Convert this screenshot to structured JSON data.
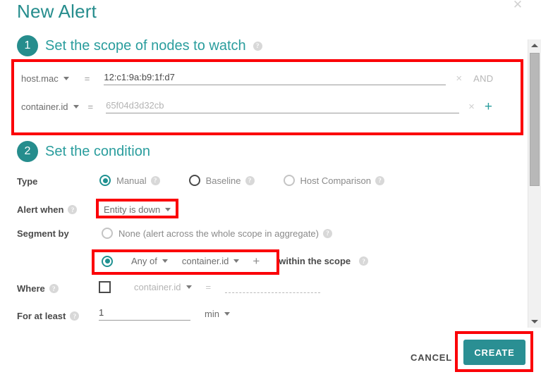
{
  "dialog": {
    "title": "New Alert",
    "close_icon": "close-icon"
  },
  "step1": {
    "number": "1",
    "title": "Set the scope of nodes to watch",
    "help": "?",
    "rows": [
      {
        "field": "host.mac",
        "operator": "=",
        "value": "12:c1:9a:b9:1f:d7",
        "placeholder": "",
        "clear_icon": "×",
        "conjunction": "AND"
      },
      {
        "field": "container.id",
        "operator": "=",
        "value": "",
        "placeholder": "65f04d3d32cb",
        "clear_icon": "×",
        "add_icon": "+"
      }
    ]
  },
  "step2": {
    "number": "2",
    "title": "Set the condition",
    "type": {
      "label": "Type",
      "options": [
        {
          "label": "Manual",
          "state": "checked",
          "help": "?"
        },
        {
          "label": "Baseline",
          "state": "dark",
          "help": "?"
        },
        {
          "label": "Host Comparison",
          "state": "unchecked",
          "help": "?"
        }
      ]
    },
    "alert_when": {
      "label": "Alert when",
      "help": "?",
      "value": "Entity is down"
    },
    "segment_by": {
      "label": "Segment by",
      "none_option": {
        "label": "None (alert across the whole scope in aggregate)",
        "state": "unchecked",
        "help": "?"
      },
      "any_option": {
        "state": "checked",
        "quantifier": "Any of",
        "field": "container.id",
        "add_icon": "+",
        "suffix": "within the scope",
        "help": "?"
      }
    },
    "where": {
      "label": "Where",
      "help": "?",
      "field": "container.id",
      "operator": "=",
      "value": "",
      "placeholder": ""
    },
    "for_at_least": {
      "label": "For at least",
      "help": "?",
      "value": "1",
      "unit": "min"
    }
  },
  "scrollbar": {
    "up_icon": "scroll-up-arrow",
    "down_icon": "scroll-down-arrow"
  },
  "footer": {
    "cancel_label": "CANCEL",
    "create_label": "CREATE"
  },
  "colors": {
    "teal": "#2a9d9d",
    "teal_dark": "#268d8d",
    "annotation_red": "#fb0007",
    "create_button": "#2a8f93"
  }
}
